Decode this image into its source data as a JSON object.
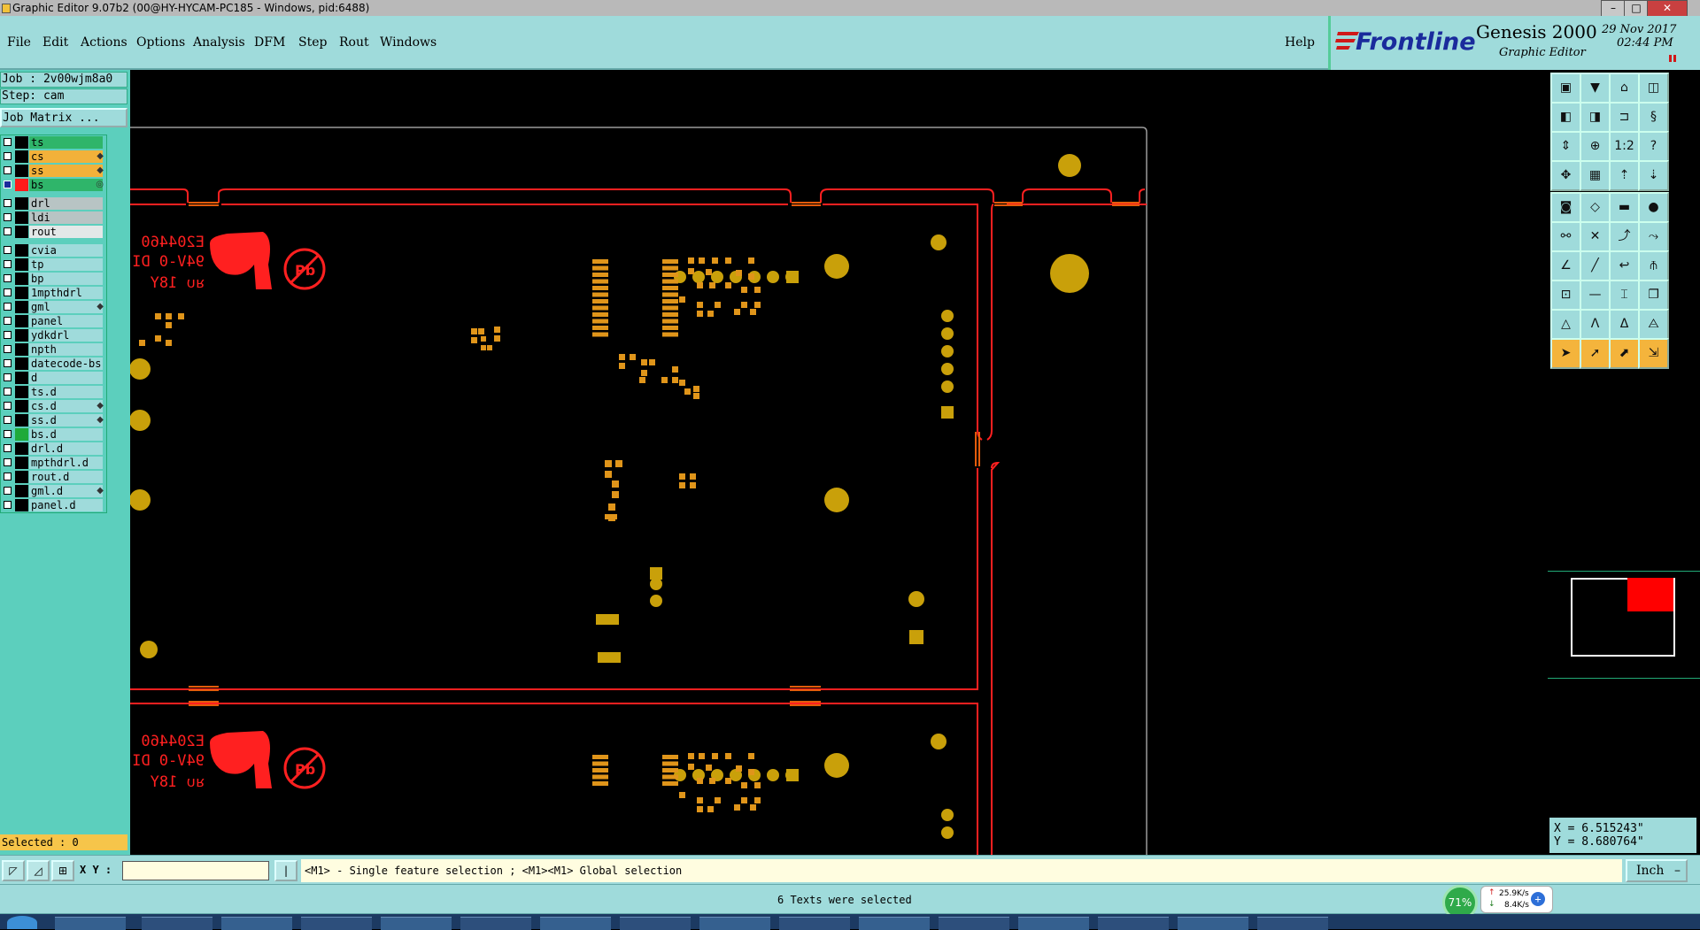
{
  "window": {
    "title": "Graphic Editor 9.07b2 (00@HY-HYCAM-PC185 - Windows, pid:6488)",
    "minimize_label": "–",
    "maximize_label": "□",
    "close_label": "✕"
  },
  "menu": {
    "items": [
      "File",
      "Edit",
      "Actions",
      "Options",
      "Analysis",
      "DFM",
      "Step",
      "Rout",
      "Windows"
    ],
    "help": "Help"
  },
  "brand": {
    "logo": "Frontline",
    "product": "Genesis 2000",
    "subtitle": "Graphic Editor",
    "date": "29 Nov 2017",
    "time": "02:44 PM"
  },
  "job": {
    "job_label": "Job : 2v00wjm8a0",
    "step_label": "Step: cam",
    "matrix_button": "Job Matrix ..."
  },
  "layers": [
    {
      "name": "ts",
      "color": "#2fb56a",
      "mark": ""
    },
    {
      "name": "cs",
      "color": "#f2b13a",
      "mark": "◆"
    },
    {
      "name": "ss",
      "color": "#f2b13a",
      "mark": "◆"
    },
    {
      "name": "bs",
      "color": "#2fb56a",
      "mark": "◎",
      "swatch": "#ff1a1a"
    },
    {
      "name": "drl",
      "color": "#b8c4c4",
      "mark": ""
    },
    {
      "name": "ldi",
      "color": "#b8c4c4",
      "mark": ""
    },
    {
      "name": "rout",
      "color": "#e3e8e8",
      "mark": ""
    },
    {
      "name": "cvia",
      "color": "#9fdbdb",
      "mark": ""
    },
    {
      "name": "tp",
      "color": "#9fdbdb",
      "mark": ""
    },
    {
      "name": "bp",
      "color": "#9fdbdb",
      "mark": ""
    },
    {
      "name": "1mpthdrl",
      "color": "#9fdbdb",
      "mark": ""
    },
    {
      "name": "gml",
      "color": "#9fdbdb",
      "mark": "◆"
    },
    {
      "name": "panel",
      "color": "#9fdbdb",
      "mark": ""
    },
    {
      "name": "ydkdrl",
      "color": "#9fdbdb",
      "mark": ""
    },
    {
      "name": "npth",
      "color": "#9fdbdb",
      "mark": ""
    },
    {
      "name": "datecode-bs",
      "color": "#9fdbdb",
      "mark": ""
    },
    {
      "name": "d",
      "color": "#9fdbdb",
      "mark": ""
    },
    {
      "name": "ts.d",
      "color": "#9fdbdb",
      "mark": ""
    },
    {
      "name": "cs.d",
      "color": "#9fdbdb",
      "mark": "◆"
    },
    {
      "name": "ss.d",
      "color": "#9fdbdb",
      "mark": "◆"
    },
    {
      "name": "bs.d",
      "color": "#9fdbdb",
      "mark": "",
      "swatch": "#1faa3a"
    },
    {
      "name": "drl.d",
      "color": "#9fdbdb",
      "mark": ""
    },
    {
      "name": "mpthdrl.d",
      "color": "#9fdbdb",
      "mark": ""
    },
    {
      "name": "rout.d",
      "color": "#9fdbdb",
      "mark": ""
    },
    {
      "name": "gml.d",
      "color": "#9fdbdb",
      "mark": "◆"
    },
    {
      "name": "panel.d",
      "color": "#9fdbdb",
      "mark": ""
    }
  ],
  "selected": "Selected : 0",
  "coordinates": {
    "x": "X = 6.515243\"",
    "y": "Y = 8.680764\""
  },
  "command": {
    "xy_label": "X Y :",
    "xy_value": "",
    "hint": "<M1> - Single feature selection ; <M1><M1> Global selection",
    "units": "Inch"
  },
  "status": {
    "message": "6 Texts were selected",
    "cpu": "71%",
    "upload": "25.9K/s",
    "download": "8.4K/s"
  },
  "board": {
    "part_number": "E204460",
    "marking": "94V-0  DI",
    "ul_code": "ᴚᴜ 18Y",
    "pb_label": "Pb"
  },
  "tools": {
    "scale_label": "1:2",
    "help_label": "?"
  },
  "colors": {
    "panel": "#9fdbdb",
    "left": "#5ccfbd",
    "highlight": "#f4b43c",
    "copper": "#c9a00a",
    "outline": "#ff2020"
  }
}
